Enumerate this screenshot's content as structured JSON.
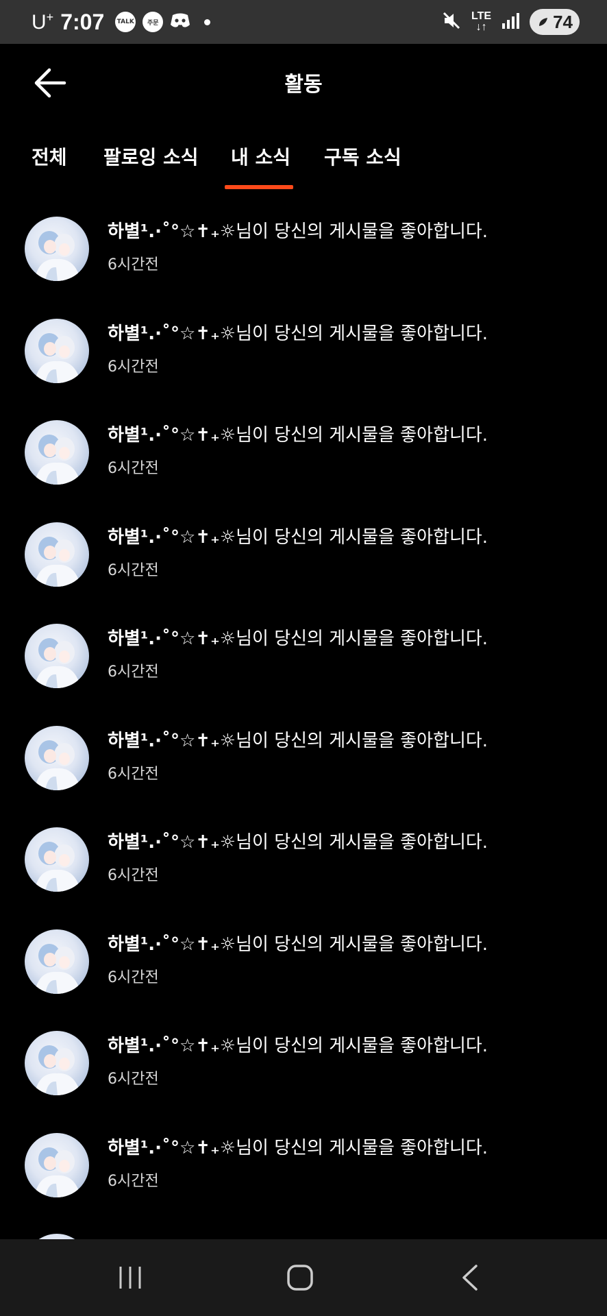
{
  "status_bar": {
    "carrier": "U",
    "carrier_sup": "+",
    "time": "7:07",
    "badges": [
      "TALK",
      "주문"
    ],
    "network": "LTE",
    "battery": "74"
  },
  "header": {
    "title": "활동"
  },
  "tabs": [
    {
      "label": "전체",
      "active": false
    },
    {
      "label": "팔로잉 소식",
      "active": false
    },
    {
      "label": "내 소식",
      "active": true
    },
    {
      "label": "구독 소식",
      "active": false
    }
  ],
  "notifications": [
    {
      "nickname": "하별¹.·˚°☆✝₊☼",
      "message": "님이 당신의 게시물을 좋아합니다.",
      "time": "6시간전"
    },
    {
      "nickname": "하별¹.·˚°☆✝₊☼",
      "message": "님이 당신의 게시물을 좋아합니다.",
      "time": "6시간전"
    },
    {
      "nickname": "하별¹.·˚°☆✝₊☼",
      "message": "님이 당신의 게시물을 좋아합니다.",
      "time": "6시간전"
    },
    {
      "nickname": "하별¹.·˚°☆✝₊☼",
      "message": "님이 당신의 게시물을 좋아합니다.",
      "time": "6시간전"
    },
    {
      "nickname": "하별¹.·˚°☆✝₊☼",
      "message": "님이 당신의 게시물을 좋아합니다.",
      "time": "6시간전"
    },
    {
      "nickname": "하별¹.·˚°☆✝₊☼",
      "message": "님이 당신의 게시물을 좋아합니다.",
      "time": "6시간전"
    },
    {
      "nickname": "하별¹.·˚°☆✝₊☼",
      "message": "님이 당신의 게시물을 좋아합니다.",
      "time": "6시간전"
    },
    {
      "nickname": "하별¹.·˚°☆✝₊☼",
      "message": "님이 당신의 게시물을 좋아합니다.",
      "time": "6시간전"
    },
    {
      "nickname": "하별¹.·˚°☆✝₊☼",
      "message": "님이 당신의 게시물을 좋아합니다.",
      "time": "6시간전"
    },
    {
      "nickname": "하별¹.·˚°☆✝₊☼",
      "message": "님이 당신의 게시물을 좋아합니다.",
      "time": "6시간전"
    }
  ],
  "colors": {
    "background": "#000000",
    "status_bar": "#333333",
    "active_tab_indicator": "#ff4a1a",
    "nav_bar": "#1a1a1a"
  },
  "icons": {
    "back": "arrow-left-icon",
    "nav_recents": "recents-icon",
    "nav_home": "home-icon",
    "nav_back": "chevron-left-icon",
    "mute": "mute-icon",
    "signal": "signal-icon"
  }
}
